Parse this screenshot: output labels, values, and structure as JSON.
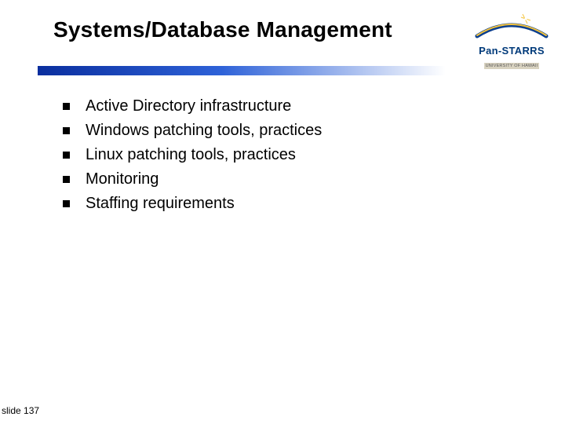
{
  "title": "Systems/Database Management",
  "logo": {
    "text": "Pan-STARRS",
    "subtext": "UNIVERSITY OF HAWAII"
  },
  "bullets": [
    "Active Directory infrastructure",
    "Windows patching tools, practices",
    "Linux patching tools, practices",
    "Monitoring",
    "Staffing requirements"
  ],
  "slide_number": "slide 137"
}
